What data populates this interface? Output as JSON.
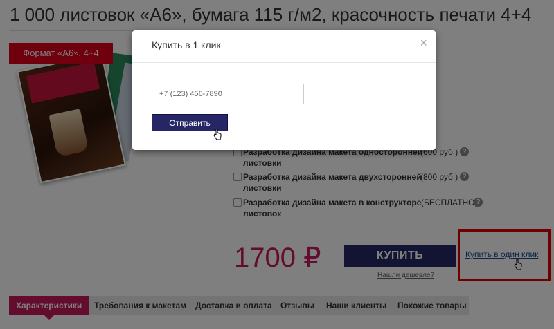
{
  "product": {
    "title": "1 000 листовок «А6», бумага 115 г/м2, красочность печати 4+4",
    "format_tag": "Формат «А6», 4+4"
  },
  "options": [
    {
      "name_line1": "Разработка дизайна макета односторонней",
      "name_line2": "листовки",
      "price": "(600 руб.)"
    },
    {
      "name_line1": "Разработка дизайна макета двухсторонней",
      "name_line2": "листовки",
      "price": "(800 руб.)"
    },
    {
      "name_line1": "Разработка дизайна макета в конструкторе",
      "name_line2": "листовок",
      "price": "(БЕСПЛАТНО)"
    }
  ],
  "price": {
    "amount": "1700",
    "currency": "₽"
  },
  "buy_button": "КУПИТЬ",
  "cheaper_link": "Нашли дешевле?",
  "one_click_link": "Купить в один клик",
  "tabs": [
    {
      "label": "Характеристики",
      "active": true
    },
    {
      "label": "Требования к макетам"
    },
    {
      "label": "Доставка и оплата"
    },
    {
      "label": "Отзывы"
    },
    {
      "label": "Наши клиенты"
    },
    {
      "label": "Похожие товары"
    }
  ],
  "modal": {
    "title": "Купить в 1 клик",
    "close": "×",
    "phone_placeholder": "+7 (123) 456-7890",
    "submit": "Отправить"
  },
  "icons": {
    "help": "question-icon",
    "cursor": "hand-pointer-icon"
  },
  "colors": {
    "accent_pink": "#c8195d",
    "button_navy": "#262666",
    "highlight_red": "#e00000"
  }
}
